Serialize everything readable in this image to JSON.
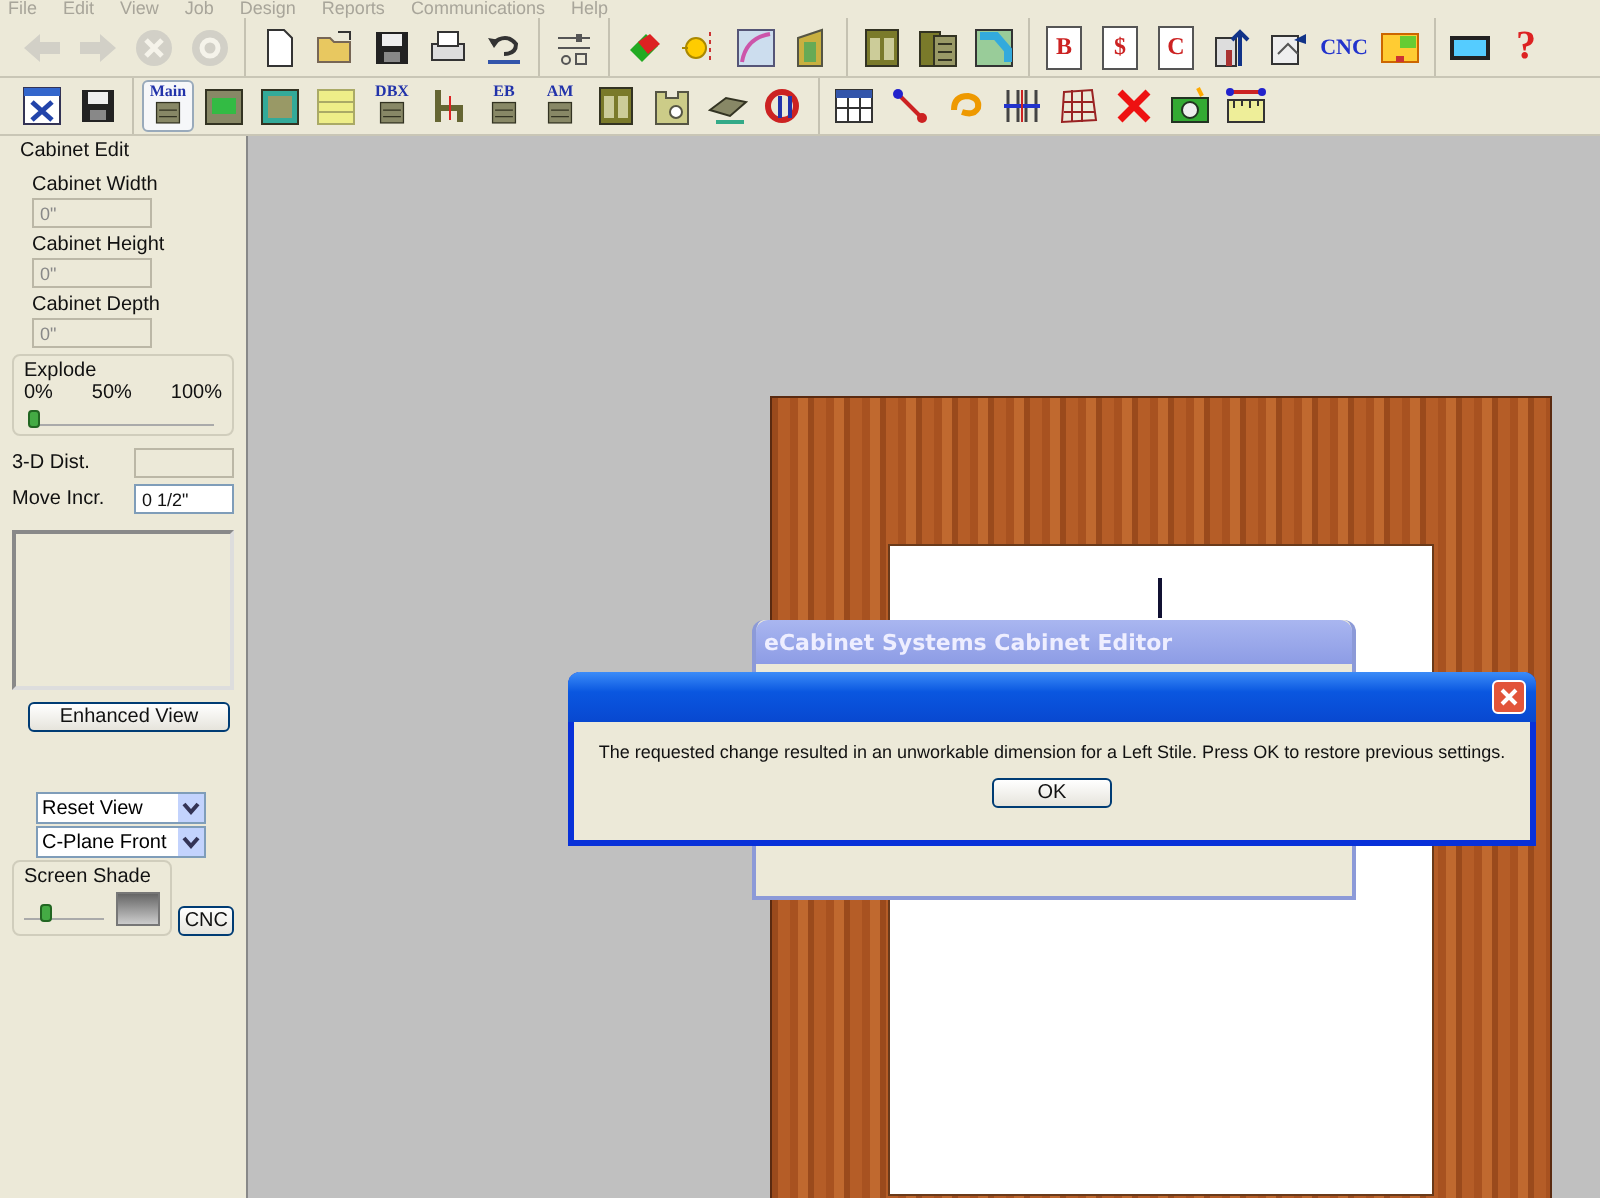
{
  "menu": [
    "File",
    "Edit",
    "View",
    "Job",
    "Design",
    "Reports",
    "Communications",
    "Help"
  ],
  "toolbar_top": [
    {
      "disabled": true,
      "items": [
        {
          "kind": "icon"
        },
        {
          "kind": "icon"
        },
        {
          "kind": "icon"
        },
        {
          "kind": "icon"
        }
      ]
    },
    {
      "disabled": false,
      "items": [
        {
          "kind": "icon"
        },
        {
          "kind": "icon"
        },
        {
          "kind": "icon"
        },
        {
          "kind": "icon"
        },
        {
          "kind": "icon"
        }
      ]
    },
    {
      "disabled": false,
      "items": [
        {
          "kind": "icon"
        }
      ]
    },
    {
      "disabled": false,
      "items": [
        {
          "kind": "icon"
        },
        {
          "kind": "icon"
        },
        {
          "kind": "icon"
        },
        {
          "kind": "icon"
        }
      ]
    },
    {
      "disabled": false,
      "items": [
        {
          "kind": "icon"
        },
        {
          "kind": "icon"
        },
        {
          "kind": "icon"
        }
      ]
    },
    {
      "disabled": false,
      "items": [
        {
          "kind": "doc",
          "text": "B"
        },
        {
          "kind": "doc",
          "text": "$"
        },
        {
          "kind": "doc",
          "text": "C"
        },
        {
          "kind": "icon"
        },
        {
          "kind": "icon"
        },
        {
          "kind": "label",
          "text": "CNC"
        },
        {
          "kind": "icon"
        }
      ]
    },
    {
      "disabled": false,
      "items": [
        {
          "kind": "icon"
        },
        {
          "kind": "mark",
          "text": "?"
        }
      ]
    }
  ],
  "toolbar_bottom": [
    {
      "items": [
        {
          "kind": "icon"
        },
        {
          "kind": "icon"
        }
      ]
    },
    {
      "items": [
        {
          "kind": "tagged",
          "text": "Main",
          "selected": true
        },
        {
          "kind": "icon",
          "selected": false
        },
        {
          "kind": "icon",
          "selected": false
        },
        {
          "kind": "icon",
          "selected": false
        },
        {
          "kind": "tagged",
          "text": "DBX",
          "selected": false
        },
        {
          "kind": "icon",
          "selected": false
        },
        {
          "kind": "tagged",
          "text": "EB",
          "selected": false
        },
        {
          "kind": "tagged",
          "text": "AM",
          "selected": false
        },
        {
          "kind": "icon",
          "selected": false
        },
        {
          "kind": "icon",
          "selected": false
        },
        {
          "kind": "icon",
          "selected": false
        },
        {
          "kind": "icon",
          "selected": false
        }
      ]
    },
    {
      "items": [
        {
          "kind": "icon"
        },
        {
          "kind": "icon"
        },
        {
          "kind": "icon"
        },
        {
          "kind": "icon"
        },
        {
          "kind": "icon"
        },
        {
          "kind": "icon"
        },
        {
          "kind": "icon"
        },
        {
          "kind": "icon"
        }
      ]
    }
  ],
  "panel": {
    "title": "Cabinet Edit",
    "fields": [
      {
        "label": "Cabinet Width",
        "value": "0\""
      },
      {
        "label": "Cabinet Height",
        "value": "0\""
      },
      {
        "label": "Cabinet Depth",
        "value": "0\""
      }
    ],
    "explode": {
      "label": "Explode",
      "ticks": [
        "0%",
        "50%",
        "100%"
      ],
      "level": 0
    },
    "dist": {
      "label": "3-D Dist."
    },
    "move": {
      "label": "Move Incr.",
      "value": "0 1/2\""
    },
    "enhanced_button": "Enhanced View",
    "selects": [
      "Reset View",
      "C-Plane Front"
    ],
    "shade": {
      "label": "Screen Shade",
      "level": 0.25
    },
    "cnc_button": "CNC"
  },
  "back_dialog": {
    "title": "eCabinet Systems Cabinet Editor"
  },
  "alert": {
    "message": "The requested change resulted in an unworkable dimension for a Left Stile.  Press OK to restore previous settings.",
    "button": "OK"
  }
}
